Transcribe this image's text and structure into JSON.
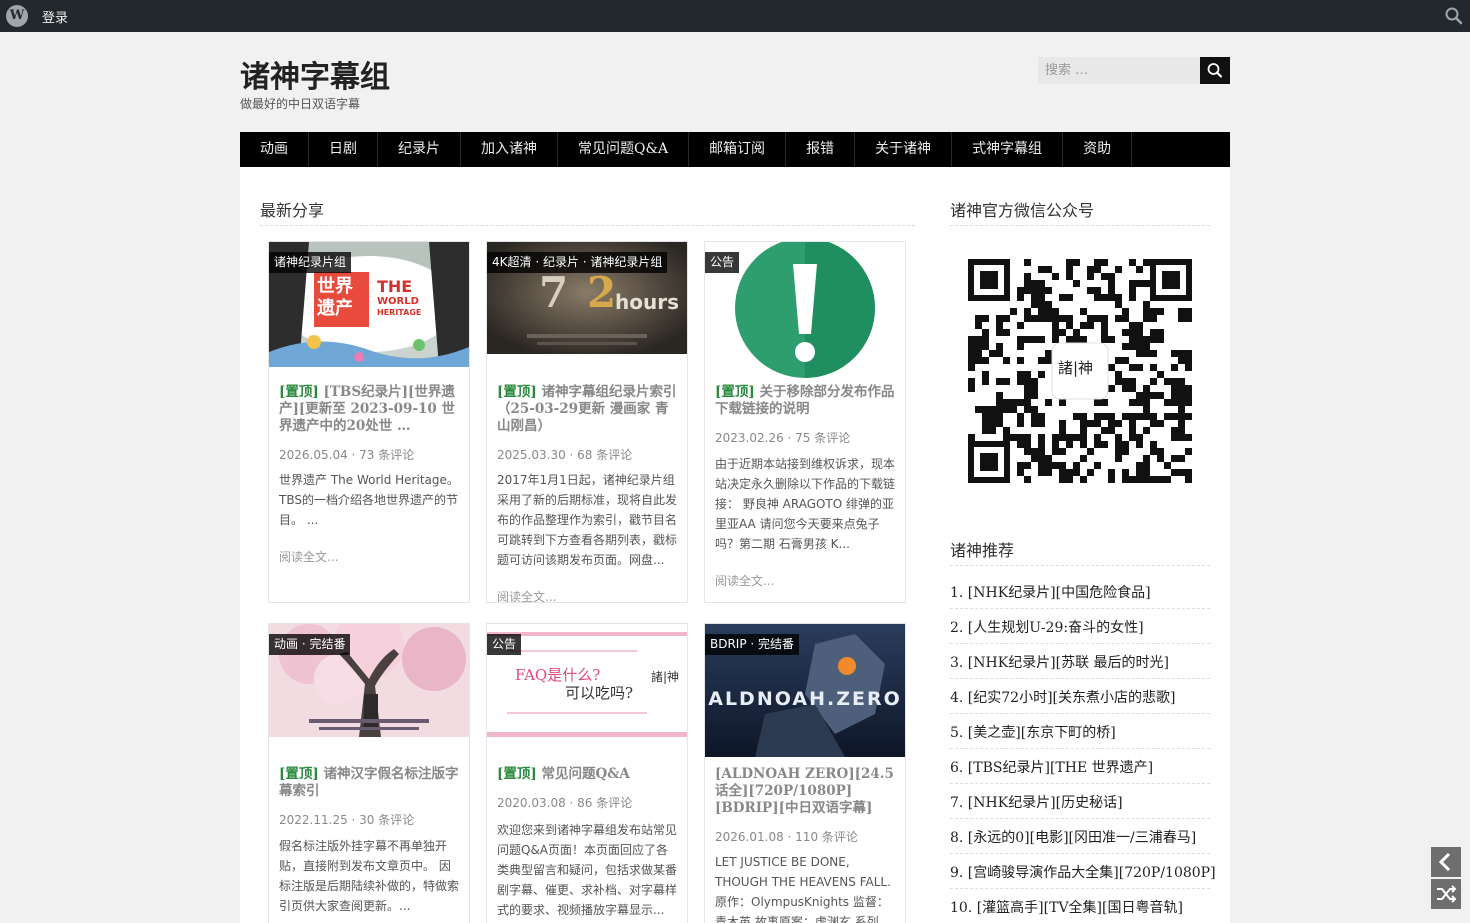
{
  "adminbar": {
    "logo": "W",
    "login": "登录",
    "search_icon": "search-icon"
  },
  "header": {
    "title": "诸神字幕组",
    "description": "做最好的中日双语字幕"
  },
  "search": {
    "placeholder": "搜索 …",
    "button_icon": "search-icon"
  },
  "nav": {
    "items": [
      "动画",
      "日剧",
      "纪录片",
      "加入诸神",
      "常见问题Q&A",
      "邮箱订阅",
      "报错",
      "关于诸神",
      "式神字幕组",
      "资助"
    ]
  },
  "content": {
    "section_title": "最新分享",
    "read_more": "阅读全文...",
    "pin_label": "[置顶]",
    "posts": [
      {
        "cats": "诸神纪录片组",
        "title": "[TBS纪录片][世界遗产][更新至 2023-09-10 世界遗产中的20处世 …",
        "pinned": true,
        "date": "2026.05.04",
        "comments": "73 条评论",
        "excerpt": "世界遗产 The World Heritage。TBS的一档介绍各地世界遗产的节目。 ...",
        "thumb_text": [
          "世界",
          "遗产",
          "THE",
          "WORLD",
          "HERITAGE"
        ]
      },
      {
        "cats": "4K超清 · 纪录片 · 诸神纪录片组",
        "title": "诸神字幕组纪录片索引（25-03-29更新 漫画家 青山刚昌）",
        "pinned": true,
        "date": "2025.03.30",
        "comments": "68 条评论",
        "excerpt": "2017年1月1日起，诸神纪录片组采用了新的后期标准，现将自此发布的作品整理作为索引，戳节目名可跳转到下方查看各期列表，戳标题可访问该期发布页面。网盘...",
        "thumb_text": [
          "7",
          "2",
          "hours"
        ]
      },
      {
        "cats": "公告",
        "title": "关于移除部分发布作品下载链接的说明",
        "pinned": true,
        "date": "2023.02.26",
        "comments": "75 条评论",
        "excerpt": "由于近期本站接到维权诉求，现本站决定永久删除以下作品的下载链接： 野良神 ARAGOTO 绯弹的亚里亚AA 请问您今天要来点兔子吗？第二期 石膏男孩 K...",
        "thumb_text": []
      },
      {
        "cats": "动画 · 完结番",
        "title": "诸神汉字假名标注版字幕索引",
        "pinned": true,
        "date": "2022.11.25",
        "comments": "30 条评论",
        "excerpt": "假名标注版外挂字幕不再单独开贴，直接附到发布文章页中。 因标注版是后期陆续补做的，特做索引页供大家查阅更新。...",
        "thumb_text": []
      },
      {
        "cats": "公告",
        "title": "常见问题Q&A",
        "pinned": true,
        "date": "2020.03.08",
        "comments": "86 条评论",
        "excerpt": "欢迎您来到诸神字幕组发布站常见问题Q&A页面！本页面回应了各类典型留言和疑问，包括求做某番剧字幕、催更、求补档、对字幕样式的要求、视频播放字幕显示...",
        "thumb_text": [
          "FAQ是什么?",
          "可以吃吗?",
          "諸|神"
        ]
      },
      {
        "cats": "BDRIP · 完结番",
        "title": "[ALDNOAH ZERO][24.5话全][720P/1080P][BDRIP][中日双语字幕]",
        "pinned": false,
        "date": "2026.01.08",
        "comments": "110 条评论",
        "excerpt": "LET JUSTICE BE DONE, THOUGH THE HEAVENS FALL. 原作：OlympusKnights 监督：青木英 故事原案：虚渊玄 系列构...",
        "thumb_text": [
          "ALDNOAH.ZERO"
        ]
      }
    ]
  },
  "sidebar": {
    "wechat_title": "诸神官方微信公众号",
    "qr_label": "諸|神",
    "rec_title": "诸神推荐",
    "recommendations": [
      "1. [NHK纪录片][中国危险食品]",
      "2. [人生规划U-29:奋斗的女性]",
      "3. [NHK纪录片][苏联 最后的时光]",
      "4. [纪实72小时][关东煮小店的悲歌]",
      "5. [美之壶][东京下町的桥]",
      "6. [TBS纪录片][THE 世界遗产]",
      "7. [NHK纪录片][历史秘话]",
      "8. [永远的0][电影][冈田准一/三浦春马]",
      "9. [宫崎骏导演作品大全集][720P/1080P]",
      "10. [灌篮高手][TV全集][国日粤音轨]"
    ]
  },
  "float_buttons": [
    "chevron-left-icon",
    "shuffle-icon"
  ]
}
